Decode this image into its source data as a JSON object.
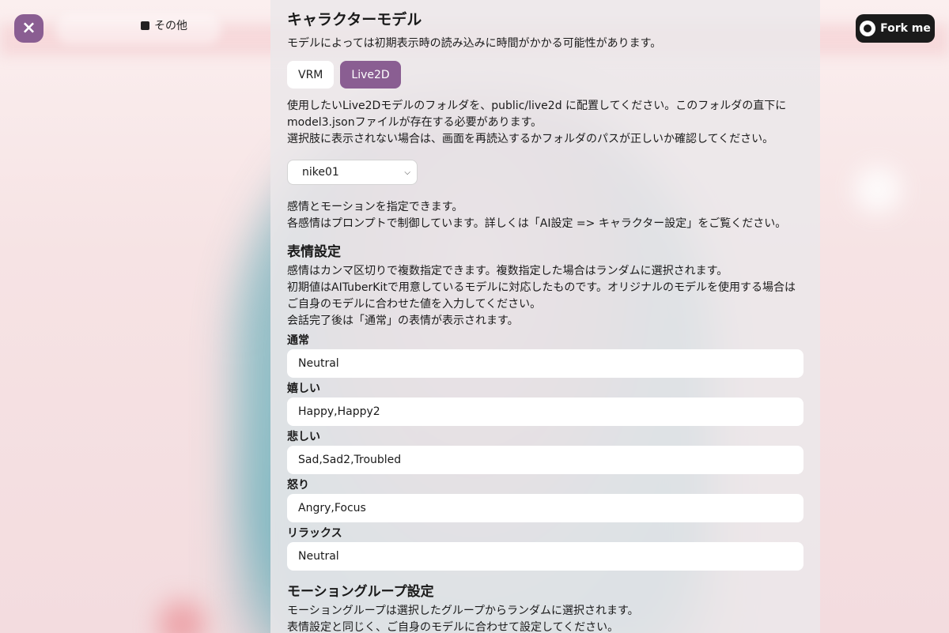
{
  "topbar": {
    "close_icon": "×",
    "other_tab": "その他",
    "fork_label": "Fork me"
  },
  "panel": {
    "title": "キャラクターモデル",
    "subtitle": "モデルによっては初期表示時の読み込みに時間がかかる可能性があります。",
    "model_types": [
      "VRM",
      "Live2D"
    ],
    "active_model_type": "Live2D",
    "desc_lines": [
      "使用したいLive2Dモデルのフォルダを、public/live2d に配置してください。このフォルダの直下に",
      "model3.jsonファイルが存在する必要があります。",
      "選択肢に表示されない場合は、画面を再読込するかフォルダのパスが正しいか確認してください。"
    ],
    "selected_model": "nike01",
    "emotion_lines": [
      "感情とモーションを指定できます。",
      "各感情はプロンプトで制御しています。詳しくは「AI設定 => キャラクター設定」をご覧ください。"
    ],
    "expression_title": "表情設定",
    "expression_lines": [
      "感情はカンマ区切りで複数指定できます。複数指定した場合はランダムに選択されます。",
      "初期値はAITuberKitで用意しているモデルに対応したものです。オリジナルのモデルを使用する場合は",
      "ご自身のモデルに合わせた値を入力してください。",
      "会話完了後は「通常」の表情が表示されます。"
    ],
    "fields": [
      {
        "label": "通常",
        "value": "Neutral"
      },
      {
        "label": "嬉しい",
        "value": "Happy,Happy2"
      },
      {
        "label": "悲しい",
        "value": "Sad,Sad2,Troubled"
      },
      {
        "label": "怒り",
        "value": "Angry,Focus"
      },
      {
        "label": "リラックス",
        "value": "Neutral"
      }
    ],
    "motion_title": "モーショングループ設定",
    "motion_lines": [
      "モーショングループは選択したグループからランダムに選択されます。",
      "表情設定と同じく、ご自身のモデルに合わせて設定してください。"
    ]
  }
}
